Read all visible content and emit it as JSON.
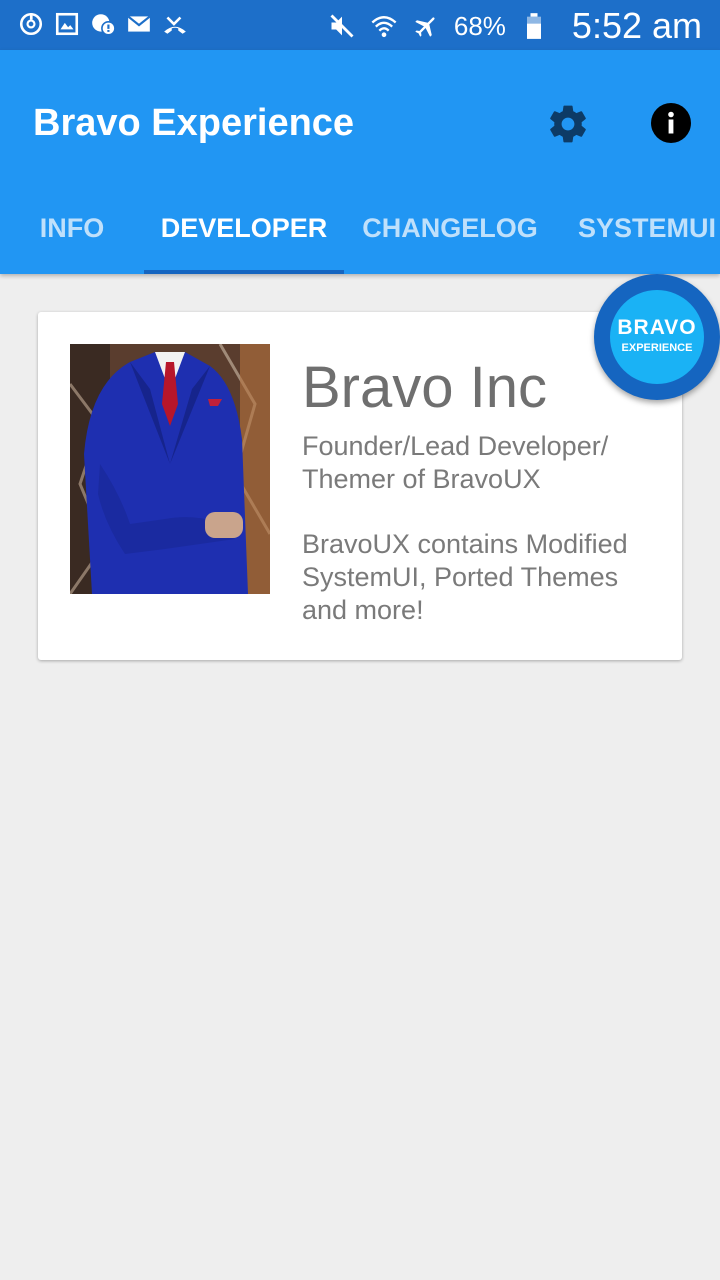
{
  "status_bar": {
    "left_icons": [
      "sync-icon",
      "gallery-icon",
      "chat-icon",
      "mail-icon",
      "missed-call-icon"
    ],
    "right_icons": [
      "mute-icon",
      "wifi-icon",
      "airplane-icon",
      "battery-icon"
    ],
    "battery": "68%",
    "time": "5:52 am"
  },
  "app_bar": {
    "title": "Bravo Experience",
    "actions": [
      "settings-icon",
      "info-icon"
    ]
  },
  "tabs": [
    {
      "label": "INFO",
      "active": false
    },
    {
      "label": "DEVELOPER",
      "active": true
    },
    {
      "label": "CHANGELOG",
      "active": false
    },
    {
      "label": "SYSTEMUI",
      "active": false
    }
  ],
  "developer_card": {
    "name": "Bravo Inc",
    "role": "Founder/Lead Developer/ Themer of BravoUX",
    "description": "BravoUX contains Modified SystemUI, Ported Themes and more!"
  },
  "fab": {
    "line1": "BRAVO",
    "line2": "EXPERIENCE"
  },
  "colors": {
    "status_bar": "#1d6fc9",
    "app_bar": "#2196f3",
    "tab_indicator": "#1565c0",
    "fab_ring": "#1565c0",
    "fab_inner": "#1ab2f5",
    "background": "#eeeeee"
  }
}
